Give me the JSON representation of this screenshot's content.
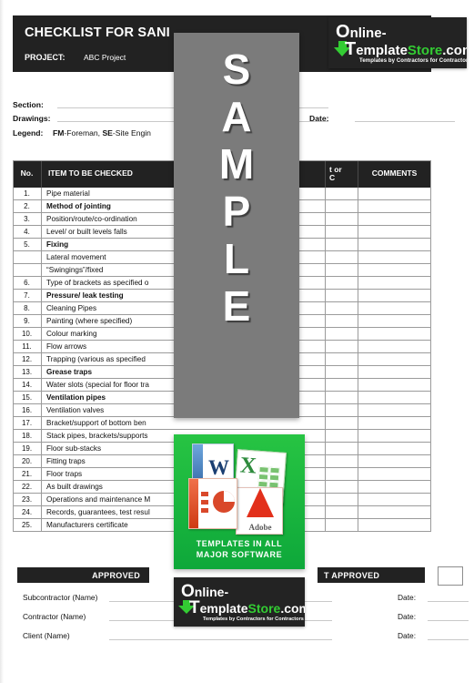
{
  "document": {
    "title": "CHECKLIST FOR SANI",
    "project_label": "PROJECT:",
    "project_value": "ABC Project"
  },
  "meta": {
    "section_label": "Section:",
    "drawings_label": "Drawings:",
    "legend_label": "Legend:",
    "legend_value_bold1": "FM",
    "legend_value_rest1": "-Foreman, ",
    "legend_value_bold2": "SE",
    "legend_value_rest2": "-Site Engin",
    "date_label": "Date:"
  },
  "table": {
    "headers": {
      "no": "No.",
      "item": "ITEM TO BE CHECKED",
      "status": "t or\nC",
      "comments": "COMMENTS"
    },
    "rows": [
      {
        "no": "1.",
        "item": "Pipe material",
        "bold": false
      },
      {
        "no": "2.",
        "item": "Method of jointing",
        "bold": true
      },
      {
        "no": "3.",
        "item": "Position/route/co-ordination",
        "bold": false
      },
      {
        "no": "4.",
        "item": "Level/ or built levels falls",
        "bold": false
      },
      {
        "no": "5.",
        "item": "Fixing",
        "bold": true
      },
      {
        "no": "",
        "item": "Lateral movement",
        "bold": false
      },
      {
        "no": "",
        "item": "“Swingings”/fixed",
        "bold": false
      },
      {
        "no": "6.",
        "item": "Type of brackets as specified o",
        "bold": false
      },
      {
        "no": "7.",
        "item": "Pressure/ leak testing",
        "bold": true
      },
      {
        "no": "8.",
        "item": "Cleaning Pipes",
        "bold": false
      },
      {
        "no": "9.",
        "item": "Painting (where specified)",
        "bold": false
      },
      {
        "no": "10.",
        "item": "Colour marking",
        "bold": false
      },
      {
        "no": "11.",
        "item": "Flow arrows",
        "bold": false
      },
      {
        "no": "12.",
        "item": "Trapping (various as specified",
        "bold": false
      },
      {
        "no": "13.",
        "item": "Grease traps",
        "bold": true
      },
      {
        "no": "14.",
        "item": "Water slots (special for floor tra",
        "bold": false
      },
      {
        "no": "15.",
        "item": "Ventilation pipes",
        "bold": true
      },
      {
        "no": "16.",
        "item": "Ventilation valves",
        "bold": false
      },
      {
        "no": "17.",
        "item": "Bracket/support of bottom ben",
        "bold": false
      },
      {
        "no": "18.",
        "item": "Stack pipes, brackets/supports",
        "bold": false
      },
      {
        "no": "19.",
        "item": "Floor sub-stacks",
        "bold": false
      },
      {
        "no": "20.",
        "item": "Fitting traps",
        "bold": false
      },
      {
        "no": "21.",
        "item": "Floor traps",
        "bold": false
      },
      {
        "no": "22.",
        "item": "As built drawings",
        "bold": false
      },
      {
        "no": "23.",
        "item": "Operations and maintenance M",
        "bold": false
      },
      {
        "no": "24.",
        "item": "Records, guarantees, test resul",
        "bold": false
      },
      {
        "no": "25.",
        "item": "Manufacturers certificate",
        "bold": false
      }
    ]
  },
  "footer": {
    "approved_label": "APPROVED",
    "not_approved_label": "T APPROVED",
    "signatories": [
      "Subcontractor (Name)",
      "Contractor (Name)",
      "Client (Name)"
    ],
    "date_labels": [
      "Date:",
      "Date:",
      "Date:"
    ]
  },
  "watermark": {
    "letters": [
      "S",
      "A",
      "M",
      "P",
      "L",
      "E"
    ]
  },
  "software_panel": {
    "caption_line1": "TEMPLATES IN ALL",
    "caption_line2": "MAJOR SOFTWARE",
    "icons": [
      "word-icon",
      "excel-icon",
      "powerpoint-icon",
      "adobe-icon"
    ],
    "word_glyph": "W",
    "excel_glyph": "X",
    "adobe_label": "Adobe"
  },
  "logo": {
    "line1_cap": "O",
    "line1_rest": "nline-",
    "line2_cap": "T",
    "line2_mid": "emplate",
    "line2_green": "Store",
    "line2_end": ".com",
    "tagline": "Templates by Contractors for Contractors"
  },
  "colors": {
    "header_black": "#222222",
    "brand_green": "#33cc33",
    "panel_green": "#27c443",
    "watermark_gray": "#7b7b7b",
    "rule_gray": "#c9c9c9",
    "table_border": "#9b9b9b"
  }
}
